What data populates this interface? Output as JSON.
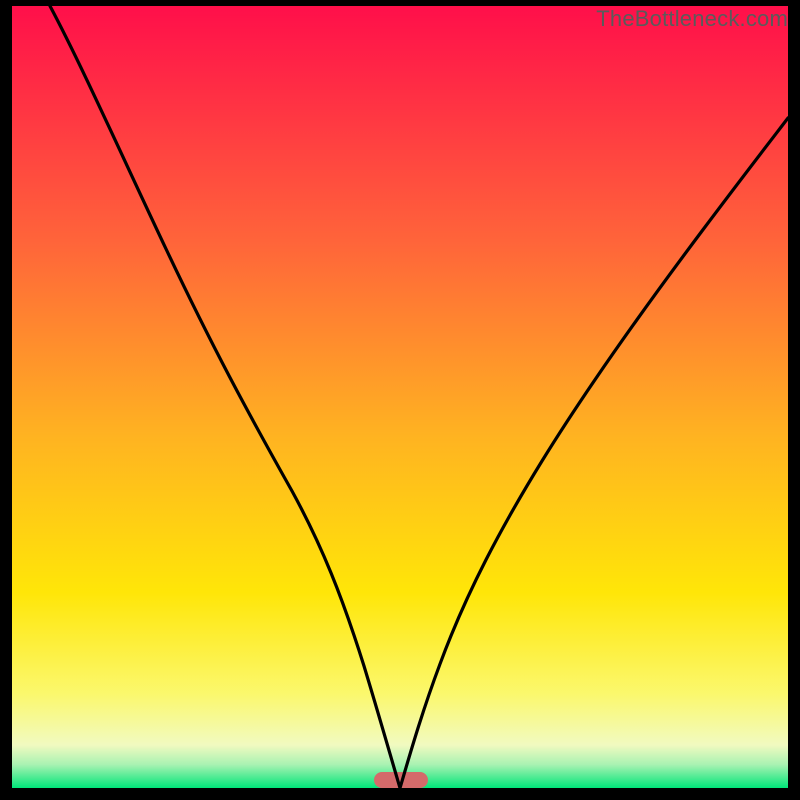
{
  "watermark": "TheBottleneck.com",
  "chart_data": {
    "type": "line",
    "title": "",
    "xlabel": "",
    "ylabel": "",
    "xlim": [
      0,
      100
    ],
    "ylim": [
      0,
      100
    ],
    "grid": false,
    "legend": false,
    "annotations": [],
    "background_gradient": {
      "stops": [
        {
          "pos": 0.0,
          "color": "#ff0f4a"
        },
        {
          "pos": 0.3,
          "color": "#ff643a"
        },
        {
          "pos": 0.55,
          "color": "#ffb321"
        },
        {
          "pos": 0.75,
          "color": "#ffe608"
        },
        {
          "pos": 0.88,
          "color": "#fbf86d"
        },
        {
          "pos": 0.945,
          "color": "#f1fac0"
        },
        {
          "pos": 0.97,
          "color": "#a9f2b2"
        },
        {
          "pos": 1.0,
          "color": "#00e579"
        }
      ]
    },
    "marker": {
      "x": 50,
      "y": 0,
      "width": 7,
      "color": "#d46a6a",
      "shape": "rounded-bar"
    },
    "series": [
      {
        "name": "curve",
        "color": "#000000",
        "x": [
          5,
          8,
          12,
          16,
          20,
          24,
          28,
          32,
          36,
          40,
          44,
          46,
          48,
          50,
          52,
          54,
          58,
          62,
          66,
          70,
          74,
          78,
          82,
          86,
          90,
          94,
          98,
          100
        ],
        "y": [
          100,
          93,
          84,
          76,
          69,
          62,
          55,
          48,
          41,
          33,
          22,
          15,
          7,
          0,
          6,
          13,
          24,
          33,
          41,
          48,
          54,
          60,
          65,
          70,
          74,
          78,
          81,
          83
        ]
      }
    ]
  }
}
